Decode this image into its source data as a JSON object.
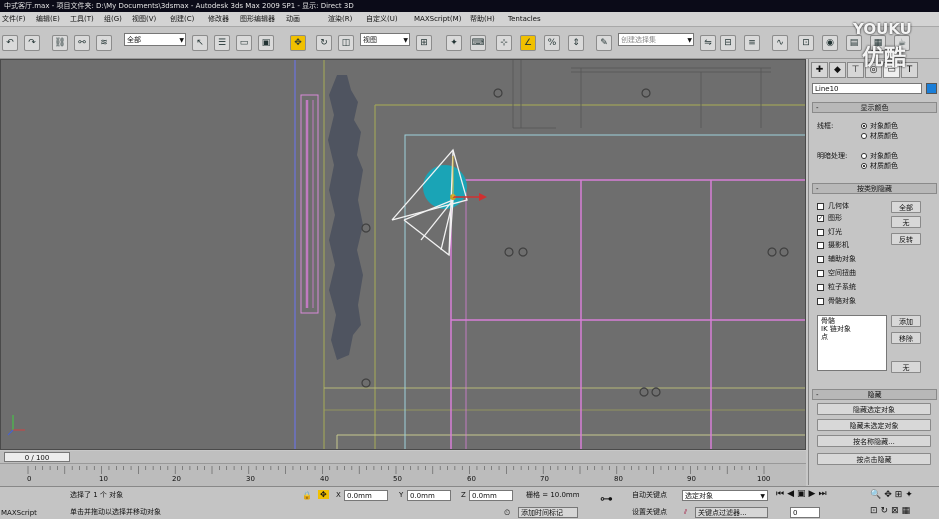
{
  "window": {
    "title": "中式客厅.max - 项目文件夹: D:\\My Documents\\3dsmax - Autodesk 3ds Max 2009 SP1 - 显示: Direct 3D"
  },
  "menu": [
    "文件(F)",
    "编辑(E)",
    "工具(T)",
    "组(G)",
    "视图(V)",
    "创建(C)",
    "修改器",
    "图形编辑器",
    "动画",
    "渲染(R)",
    "自定义(U)",
    "MAXScript(M)",
    "帮助(H)",
    "Tentacles"
  ],
  "toolbar": {
    "selection_filter": "全部",
    "reference_coord": "视图",
    "named_selection_placeholder": "创建选择集"
  },
  "command_panel": {
    "object_name": "Line10",
    "object_color": "#1a7ed8",
    "display_color": {
      "header": "显示颜色",
      "wireframe_label": "线框:",
      "wireframe_options": [
        "对象颜色",
        "材质颜色"
      ],
      "wireframe_selected": 0,
      "shaded_label": "明暗处理:",
      "shaded_options": [
        "对象颜色",
        "材质颜色"
      ],
      "shaded_selected": 1
    },
    "hide_by_category": {
      "header": "按类别隐藏",
      "categories": [
        {
          "label": "几何体",
          "checked": false
        },
        {
          "label": "图形",
          "checked": true
        },
        {
          "label": "灯光",
          "checked": false
        },
        {
          "label": "摄影机",
          "checked": false
        },
        {
          "label": "辅助对象",
          "checked": false
        },
        {
          "label": "空间扭曲",
          "checked": false
        },
        {
          "label": "粒子系统",
          "checked": false
        },
        {
          "label": "骨骼对象",
          "checked": false
        }
      ],
      "btn_all": "全部",
      "btn_none": "无",
      "btn_invert": "反转",
      "list_items": [
        "骨骼",
        "IK 链对象",
        "点"
      ],
      "btn_add": "添加",
      "btn_remove": "移除",
      "btn_none2": "无"
    },
    "hide": {
      "header": "隐藏",
      "buttons": [
        "隐藏选定对象",
        "隐藏未选定对象",
        "按名称隐藏...",
        "按点击隐藏"
      ]
    }
  },
  "timeline": {
    "slider_label": "0 / 100",
    "ticks": [
      "0",
      "10",
      "20",
      "30",
      "40",
      "50",
      "60",
      "70",
      "80",
      "90",
      "100"
    ]
  },
  "status": {
    "selection_text": "选择了 1 个 对象",
    "prompt_text": "单击并拖动以选择并移动对象",
    "x_value": "0.0mm",
    "y_value": "0.0mm",
    "z_value": "0.0mm",
    "grid_text": "栅格 = 10.0mm",
    "add_time_tag": "添加时间标记",
    "auto_key": "自动关键点",
    "selected_object": "选定对象",
    "set_key": "设置关键点",
    "key_filters": "关键点过滤器...",
    "frame_value": "0",
    "maxscript_label": "MAXScript"
  },
  "watermark": {
    "brand": "YOUKU",
    "brand_cn": "优酷"
  }
}
